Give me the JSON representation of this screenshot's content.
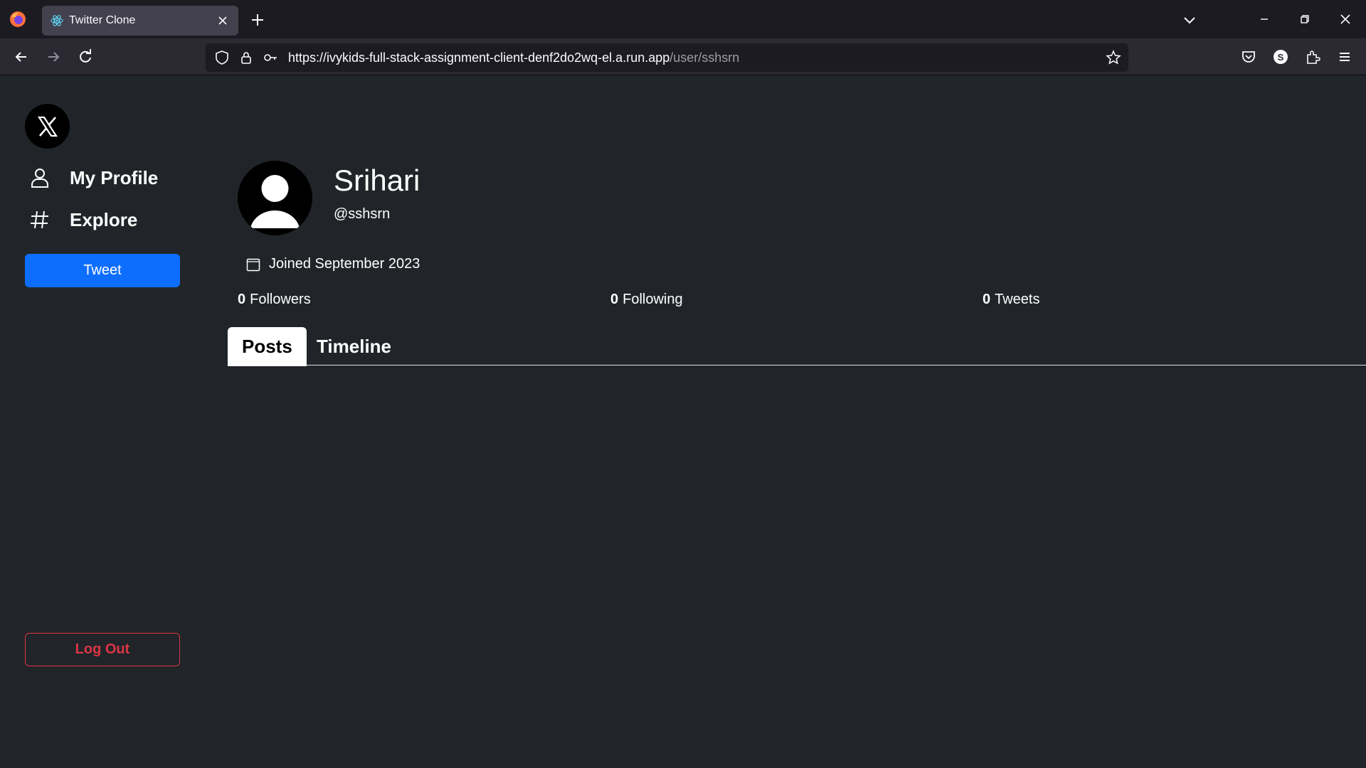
{
  "browser": {
    "tab_title": "Twitter Clone",
    "url_host": "https://ivykids-full-stack-assignment-client-denf2do2wq-el.a.run.app",
    "url_path": "/user/sshsrn"
  },
  "sidebar": {
    "items": [
      {
        "label": "My Profile",
        "icon": "user-icon"
      },
      {
        "label": "Explore",
        "icon": "hash-icon"
      }
    ],
    "tweet_label": "Tweet",
    "logout_label": "Log Out"
  },
  "profile": {
    "name": "Srihari",
    "handle": "@sshsrn",
    "joined": "Joined September 2023",
    "stats": {
      "followers_count": "0",
      "followers_label": "Followers",
      "following_count": "0",
      "following_label": "Following",
      "tweets_count": "0",
      "tweets_label": "Tweets"
    }
  },
  "tabs": [
    {
      "label": "Posts",
      "active": true
    },
    {
      "label": "Timeline",
      "active": false
    }
  ],
  "colors": {
    "primary": "#0d6efd",
    "danger": "#dc3545",
    "background": "#212529"
  }
}
